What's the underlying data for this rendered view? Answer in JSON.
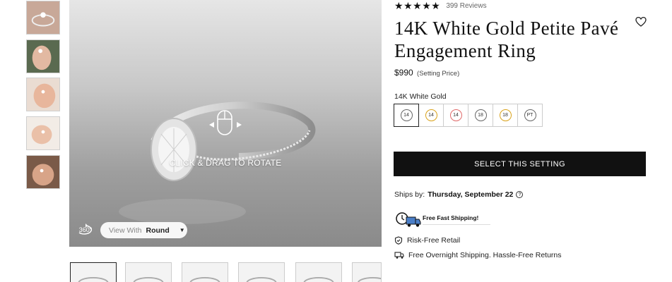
{
  "gallery": {
    "thumbnails": [
      "ring-front-thumb",
      "hand-pose-1-thumb",
      "hand-pose-2-thumb",
      "hand-pose-3-thumb",
      "hand-pose-4-thumb"
    ],
    "viewer": {
      "drag_label": "CLICK & DRAG TO ROTATE",
      "view_with_label": "View With",
      "view_with_value": "Round",
      "rotate_badge": "360°"
    },
    "bottom_thumbnails": 6
  },
  "product": {
    "rating_stars": 5,
    "reviews": "399 Reviews",
    "title": "14K White Gold Petite Pavé Engagement Ring",
    "price": "$990",
    "price_note": "(Setting Price)",
    "metal_label": "14K White Gold",
    "metals": [
      {
        "label": "14",
        "color": "#666666"
      },
      {
        "label": "14",
        "color": "#d9a21a"
      },
      {
        "label": "14",
        "color": "#e06a6a"
      },
      {
        "label": "18",
        "color": "#666666"
      },
      {
        "label": "18",
        "color": "#d9a21a"
      },
      {
        "label": "PT",
        "color": "#666666"
      }
    ],
    "cta": "SELECT THIS SETTING",
    "ships_prefix": "Ships by:",
    "ships_date": "Thursday, September 22",
    "shipping_badge": "Free Fast Shipping!",
    "features": [
      "Risk-Free Retail",
      "Free Overnight Shipping. Hassle-Free Returns"
    ]
  }
}
